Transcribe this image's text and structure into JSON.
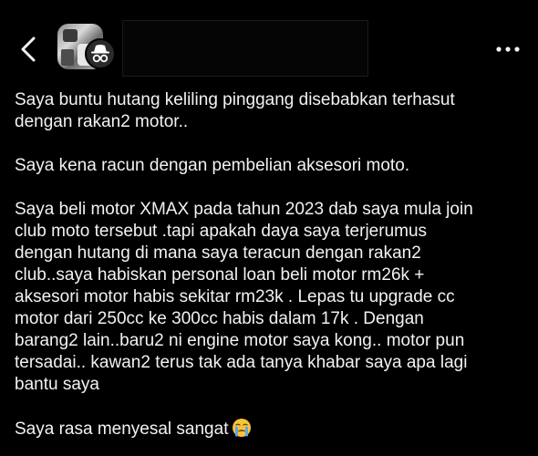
{
  "header": {
    "back_icon": "chevron-left-icon",
    "avatar_icon": "anonymous-incognito-icon",
    "more_icon": "more-horizontal-icon"
  },
  "post": {
    "paragraphs": [
      "Saya buntu hutang keliling pinggang disebabkan terhasut\ndengan rakan2 motor..",
      "Saya kena racun dengan pembelian aksesori moto.",
      "Saya beli motor XMAX pada tahun 2023 dab saya mula join\nclub moto tersebut .tapi apakah daya saya terjerumus\ndengan hutang di mana saya teracun dengan rakan2\nclub..saya habiskan personal loan beli motor rm26k +\naksesori motor habis sekitar rm23k . Lepas tu upgrade cc\nmotor dari 250cc ke 300cc habis dalam 17k . Dengan\nbarang2 lain..baru2 ni engine motor saya kong.. motor pun\ntersadai.. kawan2 terus tak ada tanya khabar saya apa lagi\nbantu saya",
      "Saya rasa menyesal sangat"
    ],
    "closing_emoji": "crying-face-emoji"
  },
  "colors": {
    "background": "#000000",
    "text": "#f2f2f2",
    "badge": "#2b2b2b",
    "emoji_yellow": "#f7c23a",
    "emoji_tears": "#5aa9e6"
  }
}
